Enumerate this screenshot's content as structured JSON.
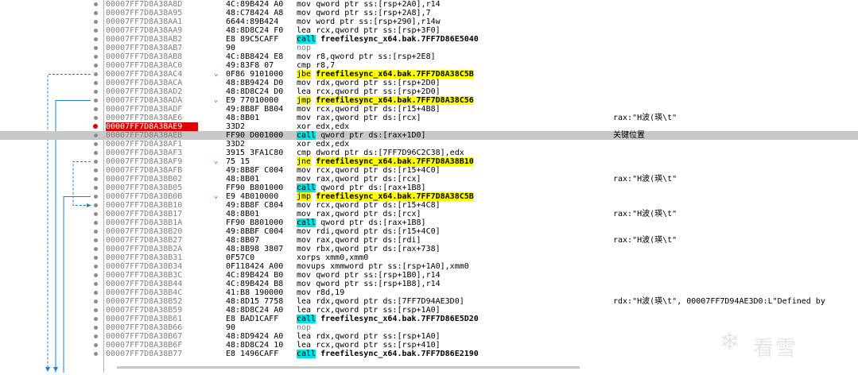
{
  "rows": [
    {
      "addr": "00007FF7D8A38A8D",
      "bytes": "4C:89B424 A0",
      "mn": "mov",
      "op": "qword ptr ss:[rsp+2A0],r14",
      "cmt": ""
    },
    {
      "addr": "00007FF7D8A38A95",
      "bytes": "48:C78424 A8",
      "mn": "mov",
      "op": "qword ptr ss:[rsp+2A8],7",
      "cmt": ""
    },
    {
      "addr": "00007FF7D8A38AA1",
      "bytes": "6644:89B424",
      "mn": "mov",
      "op": "word ptr ss:[rsp+290],r14w",
      "cmt": ""
    },
    {
      "addr": "00007FF7D8A38AA9",
      "bytes": "48:8D8C24 F0",
      "mn": "lea",
      "op": "rcx,qword ptr ss:[rsp+3F0]",
      "cmt": ""
    },
    {
      "addr": "00007FF7D8A38AB2",
      "bytes": "E8 89C5CAFF",
      "mn": "call",
      "op": "freefilesync_x64.bak.7FF7D86E5040",
      "cmt": ""
    },
    {
      "addr": "00007FF7D8A38AB7",
      "bytes": "90",
      "mn": "nop",
      "op": "",
      "cmt": ""
    },
    {
      "addr": "00007FF7D8A38AB8",
      "bytes": "4C:8B8424 E8",
      "mn": "mov",
      "op": "r8,qword ptr ss:[rsp+2E8]",
      "cmt": ""
    },
    {
      "addr": "00007FF7D8A38AC0",
      "bytes": "49:83F8 07",
      "mn": "cmp",
      "op": "r8,7",
      "cmt": ""
    },
    {
      "addr": "00007FF7D8A38AC4",
      "bytes": "0F86 9101000",
      "mn": "jbe",
      "op": "freefilesync_x64.bak.7FF7D8A38C5B",
      "cmt": ""
    },
    {
      "addr": "00007FF7D8A38ACA",
      "bytes": "48:8B9424 D0",
      "mn": "mov",
      "op": "rdx,qword ptr ss:[rsp+2D0]",
      "cmt": ""
    },
    {
      "addr": "00007FF7D8A38AD2",
      "bytes": "48:8D8C24 D0",
      "mn": "lea",
      "op": "rcx,qword ptr ss:[rsp+2D0]",
      "cmt": ""
    },
    {
      "addr": "00007FF7D8A38ADA",
      "bytes": "E9 77010000",
      "mn": "jmp",
      "op": "freefilesync_x64.bak.7FF7D8A38C56",
      "cmt": ""
    },
    {
      "addr": "00007FF7D8A38ADF",
      "bytes": "49:8B8F B804",
      "mn": "mov",
      "op": "rcx,qword ptr ds:[r15+4B8]",
      "cmt": ""
    },
    {
      "addr": "00007FF7D8A38AE6",
      "bytes": "48:8B01",
      "mn": "mov",
      "op": "rax,qword ptr ds:[rcx]",
      "cmt": "rax:\"H波(瑛\\t\""
    },
    {
      "addr": "00007FF7D8A38AE9",
      "bytes": "33D2",
      "mn": "xor",
      "op": "edx,edx",
      "cmt": ""
    },
    {
      "addr": "00007FF7D8A38AEB",
      "bytes": "FF90 D001000",
      "mn": "call",
      "op": "qword ptr ds:[rax+1D0]",
      "cmt": "关键位置"
    },
    {
      "addr": "00007FF7D8A38AF1",
      "bytes": "33D2",
      "mn": "xor",
      "op": "edx,edx",
      "cmt": ""
    },
    {
      "addr": "00007FF7D8A38AF3",
      "bytes": "3915 3FA1C80",
      "mn": "cmp",
      "op": "dword ptr ds:[7FF7D96C2C38],edx",
      "cmt": ""
    },
    {
      "addr": "00007FF7D8A38AF9",
      "bytes": "75 15",
      "mn": "jne",
      "op": "freefilesync_x64.bak.7FF7D8A38B10",
      "cmt": ""
    },
    {
      "addr": "00007FF7D8A38AFB",
      "bytes": "49:8B8F C004",
      "mn": "mov",
      "op": "rcx,qword ptr ds:[r15+4C0]",
      "cmt": ""
    },
    {
      "addr": "00007FF7D8A38B02",
      "bytes": "48:8B01",
      "mn": "mov",
      "op": "rax,qword ptr ds:[rcx]",
      "cmt": "rax:\"H波(瑛\\t\""
    },
    {
      "addr": "00007FF7D8A38B05",
      "bytes": "FF90 B801000",
      "mn": "call",
      "op": "qword ptr ds:[rax+1B8]",
      "cmt": ""
    },
    {
      "addr": "00007FF7D8A38B0B",
      "bytes": "E9 4B010000",
      "mn": "jmp",
      "op": "freefilesync_x64.bak.7FF7D8A38C5B",
      "cmt": ""
    },
    {
      "addr": "00007FF7D8A38B10",
      "bytes": "49:8B8F C804",
      "mn": "mov",
      "op": "rcx,qword ptr ds:[r15+4C8]",
      "cmt": ""
    },
    {
      "addr": "00007FF7D8A38B17",
      "bytes": "48:8B01",
      "mn": "mov",
      "op": "rax,qword ptr ds:[rcx]",
      "cmt": "rax:\"H波(瑛\\t\""
    },
    {
      "addr": "00007FF7D8A38B1A",
      "bytes": "FF90 B801000",
      "mn": "call",
      "op": "qword ptr ds:[rax+1B8]",
      "cmt": ""
    },
    {
      "addr": "00007FF7D8A38B20",
      "bytes": "49:8BBF C004",
      "mn": "mov",
      "op": "rdi,qword ptr ds:[r15+4C0]",
      "cmt": ""
    },
    {
      "addr": "00007FF7D8A38B27",
      "bytes": "48:8B07",
      "mn": "mov",
      "op": "rax,qword ptr ds:[rdi]",
      "cmt": "rax:\"H波(瑛\\t\""
    },
    {
      "addr": "00007FF7D8A38B2A",
      "bytes": "48:8B98 3807",
      "mn": "mov",
      "op": "rbx,qword ptr ds:[rax+738]",
      "cmt": ""
    },
    {
      "addr": "00007FF7D8A38B31",
      "bytes": "0F57C0",
      "mn": "xorps",
      "op": "xmm0,xmm0",
      "cmt": ""
    },
    {
      "addr": "00007FF7D8A38B34",
      "bytes": "0F118424 A00",
      "mn": "movups",
      "op": "xmmword ptr ss:[rsp+1A0],xmm0",
      "cmt": ""
    },
    {
      "addr": "00007FF7D8A38B3C",
      "bytes": "4C:89B424 B0",
      "mn": "mov",
      "op": "qword ptr ss:[rsp+1B0],r14",
      "cmt": ""
    },
    {
      "addr": "00007FF7D8A38B44",
      "bytes": "4C:89B424 B8",
      "mn": "mov",
      "op": "qword ptr ss:[rsp+1B8],r14",
      "cmt": ""
    },
    {
      "addr": "00007FF7D8A38B4C",
      "bytes": "41:B8 190000",
      "mn": "mov",
      "op": "r8d,19",
      "cmt": ""
    },
    {
      "addr": "00007FF7D8A38B52",
      "bytes": "48:8D15 7758",
      "mn": "lea",
      "op": "rdx,qword ptr ds:[7FF7D94AE3D0]",
      "cmt": "rdx:\"H波(瑛\\t\", 00007FF7D94AE3D0:L\"Defined by"
    },
    {
      "addr": "00007FF7D8A38B59",
      "bytes": "48:8D8C24 A0",
      "mn": "lea",
      "op": "rcx,qword ptr ss:[rsp+1A0]",
      "cmt": ""
    },
    {
      "addr": "00007FF7D8A38B61",
      "bytes": "E8 BAD1CAFF",
      "mn": "call",
      "op": "freefilesync_x64.bak.7FF7D86E5D20",
      "cmt": ""
    },
    {
      "addr": "00007FF7D8A38B66",
      "bytes": "90",
      "mn": "nop",
      "op": "",
      "cmt": ""
    },
    {
      "addr": "00007FF7D8A38B67",
      "bytes": "48:8D9424 A0",
      "mn": "lea",
      "op": "rdx,qword ptr ss:[rsp+1A0]",
      "cmt": ""
    },
    {
      "addr": "00007FF7D8A38B6F",
      "bytes": "48:8D8C24 10",
      "mn": "lea",
      "op": "rcx,qword ptr ss:[rsp+410]",
      "cmt": ""
    },
    {
      "addr": "00007FF7D8A38B77",
      "bytes": "E8 1496CAFF",
      "mn": "call",
      "op": "freefilesync_x64.bak.7FF7D86E2190",
      "cmt": ""
    }
  ],
  "selected_index": 14,
  "highlight_index": 15,
  "arrow_rows": [
    8,
    11,
    18,
    22
  ],
  "watermark": {
    "icon": "❄",
    "text": "看雪"
  },
  "colors": {
    "call": "#00e0e0",
    "jump": "#ffff00",
    "breakpoint": "#e00000",
    "highlight": "#c8c8c8"
  }
}
